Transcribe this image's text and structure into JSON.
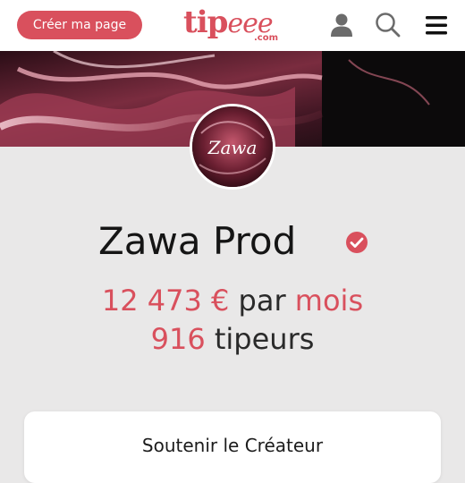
{
  "header": {
    "create_page_label": "Créer ma page",
    "logo_text": "tip",
    "logo_script": "eee",
    "logo_domain": ".com",
    "icons": [
      "user-icon",
      "search-icon",
      "menu-icon"
    ]
  },
  "creator": {
    "name": "Zawa Prod",
    "verified": true,
    "avatar_text": "Zawa",
    "amount_value": "12 473 €",
    "amount_word_par": "par",
    "amount_word_mois": "mois",
    "tippers_count": "916",
    "tippers_label": "tipeurs"
  },
  "support": {
    "title": "Soutenir le Créateur"
  },
  "colors": {
    "accent": "#d9505d",
    "background": "#e9e8e8",
    "text": "#151515"
  }
}
